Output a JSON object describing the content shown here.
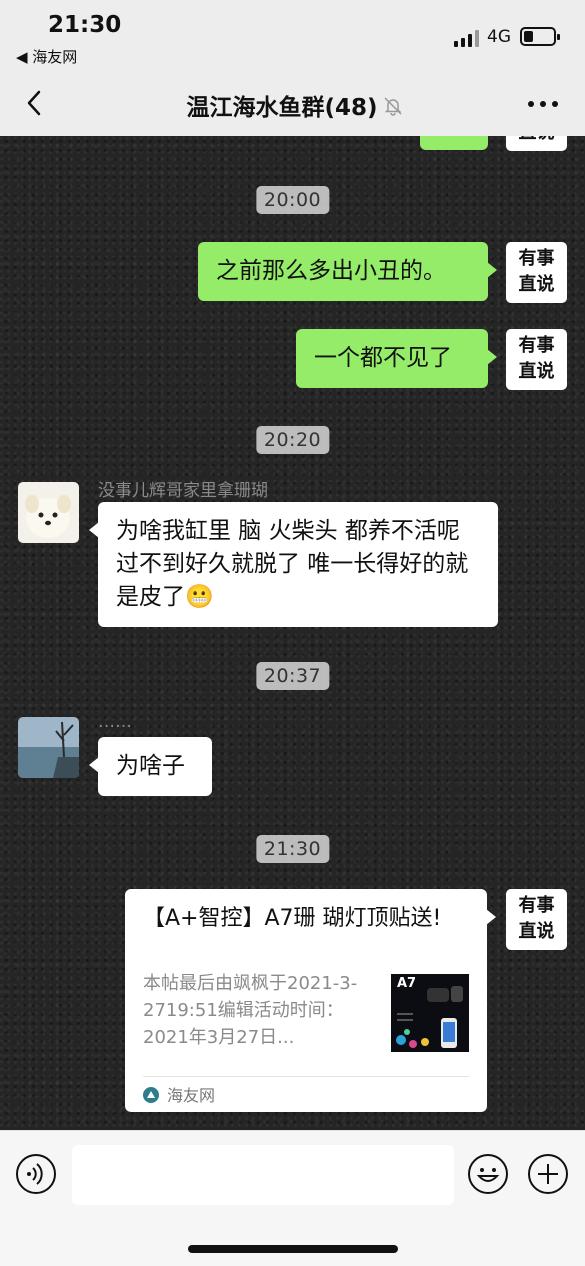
{
  "status_bar": {
    "time": "21:30",
    "back_app": "◀ 海友网",
    "network": "4G"
  },
  "nav": {
    "title": "温江海水鱼群(48)",
    "back_icon": "chevron-left-icon",
    "mute_icon": "bell-mute-icon",
    "more_icon": "more-dots-icon"
  },
  "self_avatar_text": "有事\n直说",
  "messages": [
    {
      "type": "time",
      "text": "20:00"
    },
    {
      "type": "out",
      "text": "之前那么多出小丑的。"
    },
    {
      "type": "out",
      "text": "一个都不见了"
    },
    {
      "type": "time",
      "text": "20:20"
    },
    {
      "type": "in",
      "sender": "没事儿辉哥家里拿珊瑚",
      "text": "为啥我缸里 脑  火柴头 都养不活呢 过不到好久就脱了  唯一长得好的就是皮了😬"
    },
    {
      "type": "time",
      "text": "20:37"
    },
    {
      "type": "in",
      "sender": "……",
      "text": "为啥子"
    },
    {
      "type": "time",
      "text": "21:30"
    },
    {
      "type": "card",
      "title": "【A+智控】A7珊 瑚灯顶贴送!",
      "desc": "本帖最后由飒枫于2021-3-2719:51编辑活动时间：2021年3月27日...",
      "thumb_label": "A7",
      "source": "海友网"
    }
  ],
  "colors": {
    "out_bubble": "#95ec69",
    "in_bubble": "#ffffff",
    "chat_bg": "#252525",
    "bar_bg": "#ededed"
  },
  "input_bar": {
    "voice_icon": "voice-icon",
    "emoji_icon": "emoji-icon",
    "plus_icon": "plus-icon"
  }
}
